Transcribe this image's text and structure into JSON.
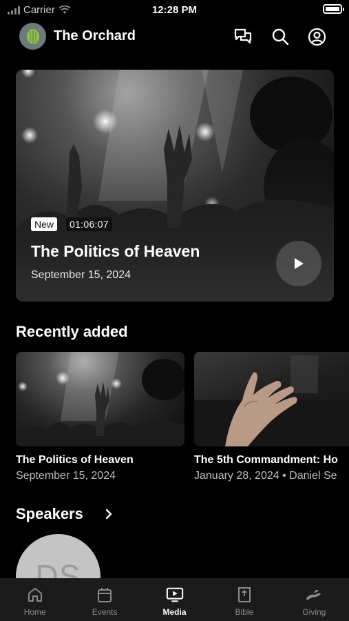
{
  "status_bar": {
    "carrier": "Carrier",
    "time": "12:28 PM"
  },
  "header": {
    "title": "The Orchard"
  },
  "featured": {
    "badge": "New",
    "duration": "01:06:07",
    "title": "The Politics of Heaven",
    "date": "September 15, 2024"
  },
  "recent": {
    "heading": "Recently added",
    "items": [
      {
        "title": "The Politics of Heaven",
        "meta": "September 15, 2024"
      },
      {
        "title": "The 5th Commandment: Ho",
        "meta": "January 28, 2024 • Daniel Se"
      }
    ]
  },
  "speakers": {
    "heading": "Speakers",
    "items": [
      {
        "initials": "DS"
      }
    ]
  },
  "tabs": [
    {
      "label": "Home",
      "icon": "home-icon"
    },
    {
      "label": "Events",
      "icon": "calendar-icon"
    },
    {
      "label": "Media",
      "icon": "tv-play-icon",
      "active": true
    },
    {
      "label": "Bible",
      "icon": "bible-icon"
    },
    {
      "label": "Giving",
      "icon": "giving-hand-icon"
    }
  ],
  "colors": {
    "background": "#000000",
    "tab_bar": "#1b1b1b",
    "inactive": "#8a8a8a",
    "logo_green": "#8dc63f"
  }
}
